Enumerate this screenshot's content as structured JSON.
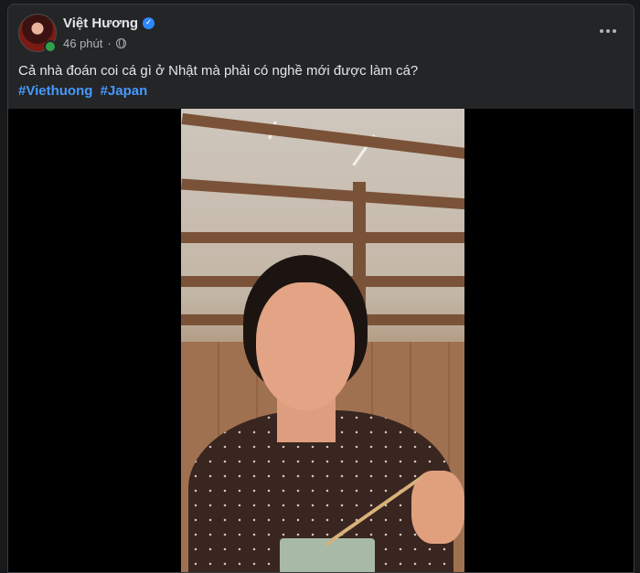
{
  "post": {
    "author": "Việt Hương",
    "time": "46 phút",
    "caption": "Cả nhà đoán coi cá gì ở Nhật mà phải có nghề mới được làm cá?",
    "hashtags": [
      "#Viethuong",
      "#Japan"
    ],
    "verified": true,
    "online": true
  },
  "icons": {
    "verified": "verified-badge-icon",
    "audience": "globe-icon",
    "more": "more-options-icon"
  },
  "colors": {
    "background": "#18191a",
    "card": "#242526",
    "text": "#e4e6eb",
    "secondary": "#b0b3b8",
    "link": "#4599ff",
    "online": "#31a24c",
    "verified": "#2d88ff"
  }
}
